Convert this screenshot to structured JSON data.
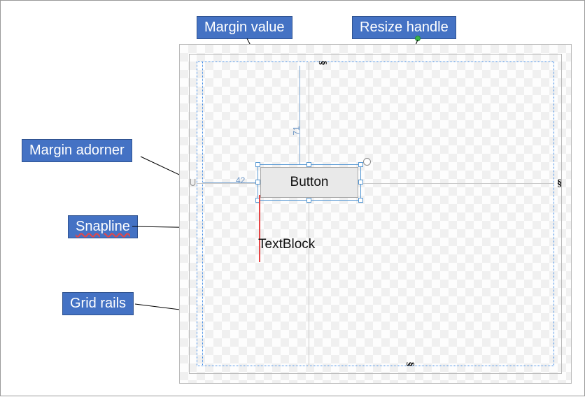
{
  "callouts": {
    "margin_value": "Margin value",
    "resize_handle": "Resize handle",
    "margin_adorner": "Margin adorner",
    "snapline": "Snapline",
    "grid_rails": "Grid rails"
  },
  "designer": {
    "button_label": "Button",
    "textblock_label": "TextBlock",
    "margin_top_value": "71",
    "margin_left_value": "42",
    "rail_glyph": "§",
    "adorner_glyph": "⊃"
  },
  "colors": {
    "callout_fill": "#4472c4",
    "callout_border": "#2f528f",
    "selection": "#5b9bd5",
    "snapline": "#e64646",
    "grid_rail": "#3e8ae6",
    "resize_dot": "#3ab54a"
  }
}
